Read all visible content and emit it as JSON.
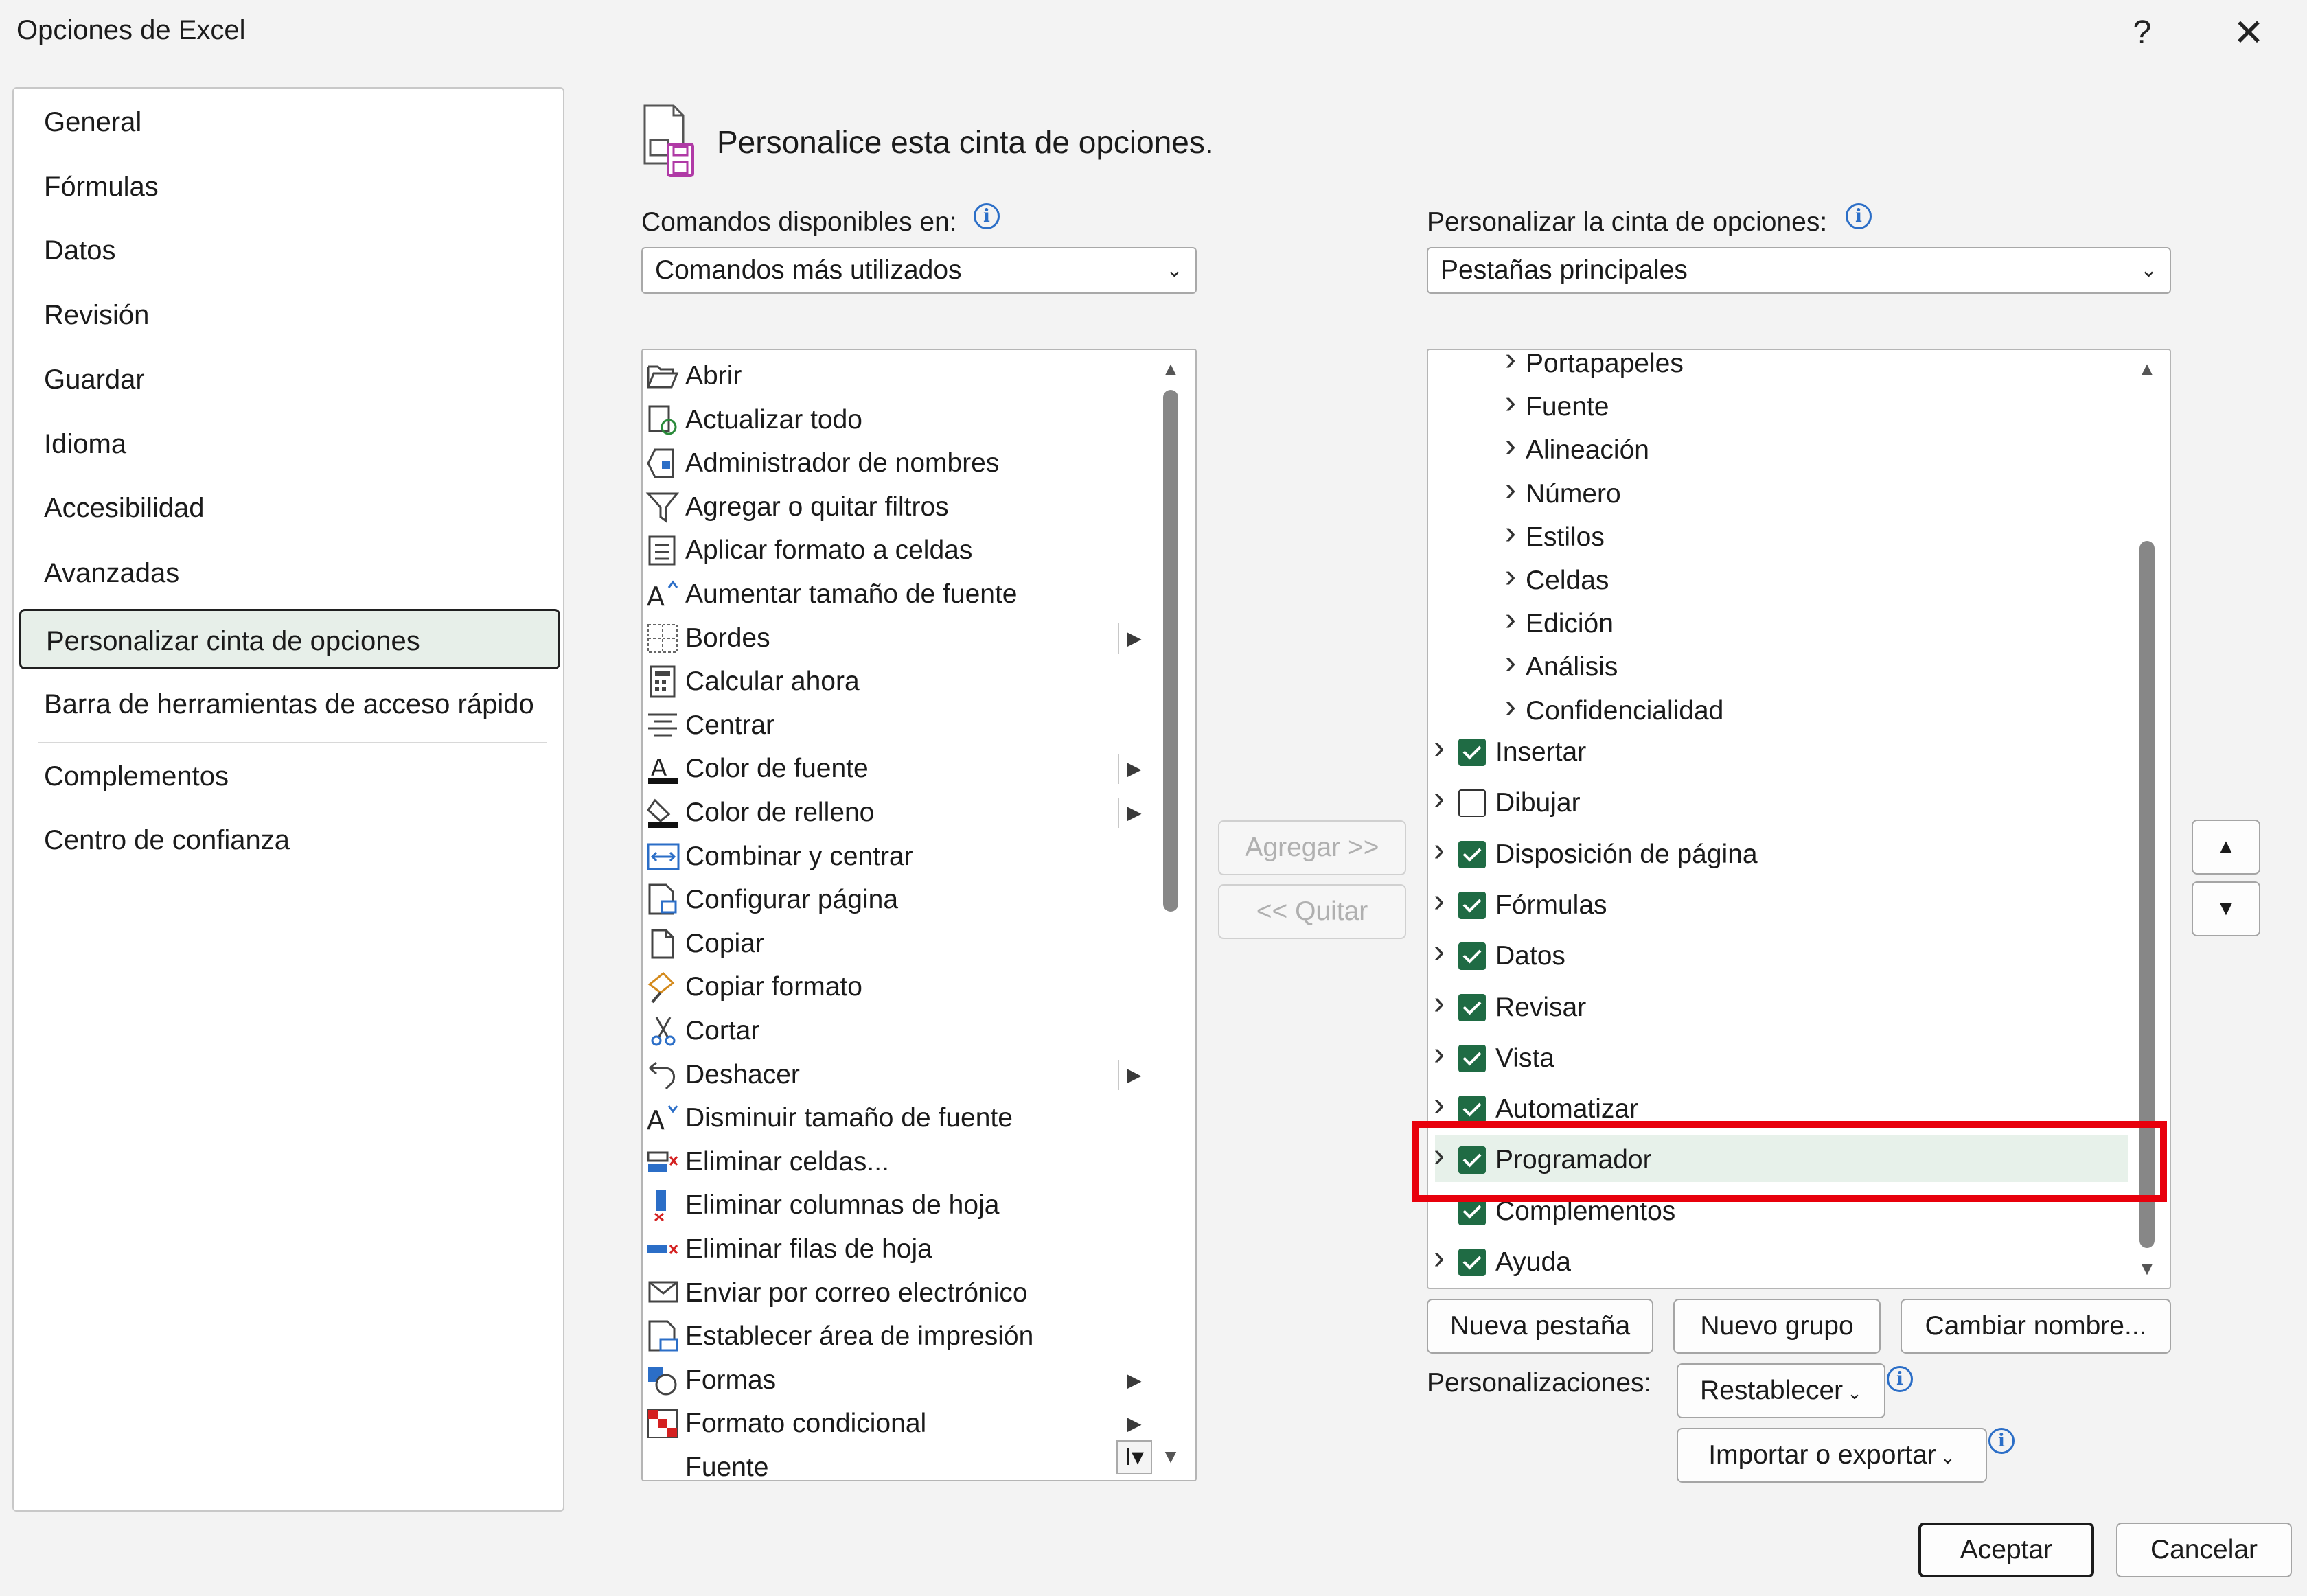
{
  "window": {
    "title": "Opciones de Excel",
    "help": "?",
    "close": "✕"
  },
  "nav": {
    "items": [
      {
        "label": "General"
      },
      {
        "label": "Fórmulas"
      },
      {
        "label": "Datos"
      },
      {
        "label": "Revisión"
      },
      {
        "label": "Guardar"
      },
      {
        "label": "Idioma"
      },
      {
        "label": "Accesibilidad"
      },
      {
        "label": "Avanzadas"
      },
      {
        "label": "Personalizar cinta de opciones",
        "selected": true
      },
      {
        "label": "Barra de herramientas de acceso rápido"
      },
      {
        "label": "Complementos"
      },
      {
        "label": "Centro de confianza"
      }
    ]
  },
  "header": {
    "title": "Personalice esta cinta de opciones.",
    "icon": "customize-ribbon-icon"
  },
  "left_panel": {
    "label": "Comandos disponibles en:",
    "dropdown_value": "Comandos más utilizados",
    "commands": [
      {
        "label": "Abrir",
        "icon": "folder-open-icon"
      },
      {
        "label": "Actualizar todo",
        "icon": "refresh-all-icon"
      },
      {
        "label": "Administrador de nombres",
        "icon": "name-manager-icon"
      },
      {
        "label": "Agregar o quitar filtros",
        "icon": "filter-icon"
      },
      {
        "label": "Aplicar formato a celdas",
        "icon": "format-cells-icon"
      },
      {
        "label": "Aumentar tamaño de fuente",
        "icon": "font-grow-icon"
      },
      {
        "label": "Bordes",
        "icon": "borders-icon",
        "submenu": true
      },
      {
        "label": "Calcular ahora",
        "icon": "calculator-icon"
      },
      {
        "label": "Centrar",
        "icon": "align-center-icon"
      },
      {
        "label": "Color de fuente",
        "icon": "font-color-icon",
        "submenu": true
      },
      {
        "label": "Color de relleno",
        "icon": "fill-color-icon",
        "submenu": true
      },
      {
        "label": "Combinar y centrar",
        "icon": "merge-center-icon"
      },
      {
        "label": "Configurar página",
        "icon": "page-setup-icon"
      },
      {
        "label": "Copiar",
        "icon": "copy-icon"
      },
      {
        "label": "Copiar formato",
        "icon": "format-painter-icon"
      },
      {
        "label": "Cortar",
        "icon": "scissors-icon"
      },
      {
        "label": "Deshacer",
        "icon": "undo-icon",
        "submenu": true
      },
      {
        "label": "Disminuir tamaño de fuente",
        "icon": "font-shrink-icon"
      },
      {
        "label": "Eliminar celdas...",
        "icon": "delete-cells-icon"
      },
      {
        "label": "Eliminar columnas de hoja",
        "icon": "delete-columns-icon"
      },
      {
        "label": "Eliminar filas de hoja",
        "icon": "delete-rows-icon"
      },
      {
        "label": "Enviar por correo electrónico",
        "icon": "email-icon"
      },
      {
        "label": "Establecer área de impresión",
        "icon": "print-area-icon"
      },
      {
        "label": "Formas",
        "icon": "shapes-icon",
        "arrow": true
      },
      {
        "label": "Formato condicional",
        "icon": "conditional-format-icon",
        "arrow": true
      },
      {
        "label": "Fuente",
        "icon": "font-box-icon"
      }
    ]
  },
  "right_panel": {
    "label": "Personalizar la cinta de opciones:",
    "dropdown_value": "Pestañas principales",
    "groups": [
      "Portapapeles",
      "Fuente",
      "Alineación",
      "Número",
      "Estilos",
      "Celdas",
      "Edición",
      "Análisis",
      "Confidencialidad"
    ],
    "tabs": [
      {
        "label": "Insertar",
        "checked": true,
        "expand": true
      },
      {
        "label": "Dibujar",
        "checked": false,
        "expand": true
      },
      {
        "label": "Disposición de página",
        "checked": true,
        "expand": true
      },
      {
        "label": "Fórmulas",
        "checked": true,
        "expand": true
      },
      {
        "label": "Datos",
        "checked": true,
        "expand": true
      },
      {
        "label": "Revisar",
        "checked": true,
        "expand": true
      },
      {
        "label": "Vista",
        "checked": true,
        "expand": true
      },
      {
        "label": "Automatizar",
        "checked": true,
        "expand": true
      },
      {
        "label": "Programador",
        "checked": true,
        "expand": true,
        "highlighted": true
      },
      {
        "label": "Complementos",
        "checked": true,
        "expand": false
      },
      {
        "label": "Ayuda",
        "checked": true,
        "expand": true
      }
    ]
  },
  "buttons": {
    "agregar": "Agregar >>",
    "quitar": "<< Quitar",
    "nueva_pestana": "Nueva pestaña",
    "nuevo_grupo": "Nuevo grupo",
    "cambiar_nombre": "Cambiar nombre...",
    "personalizaciones_label": "Personalizaciones:",
    "restablecer": "Restablecer",
    "importar": "Importar o exportar",
    "aceptar": "Aceptar",
    "cancelar": "Cancelar"
  },
  "colors": {
    "highlight_border": "#e8000c",
    "checkbox": "#1f6b44",
    "selected_nav": "#e7efe9",
    "info": "#2b6ec7"
  }
}
